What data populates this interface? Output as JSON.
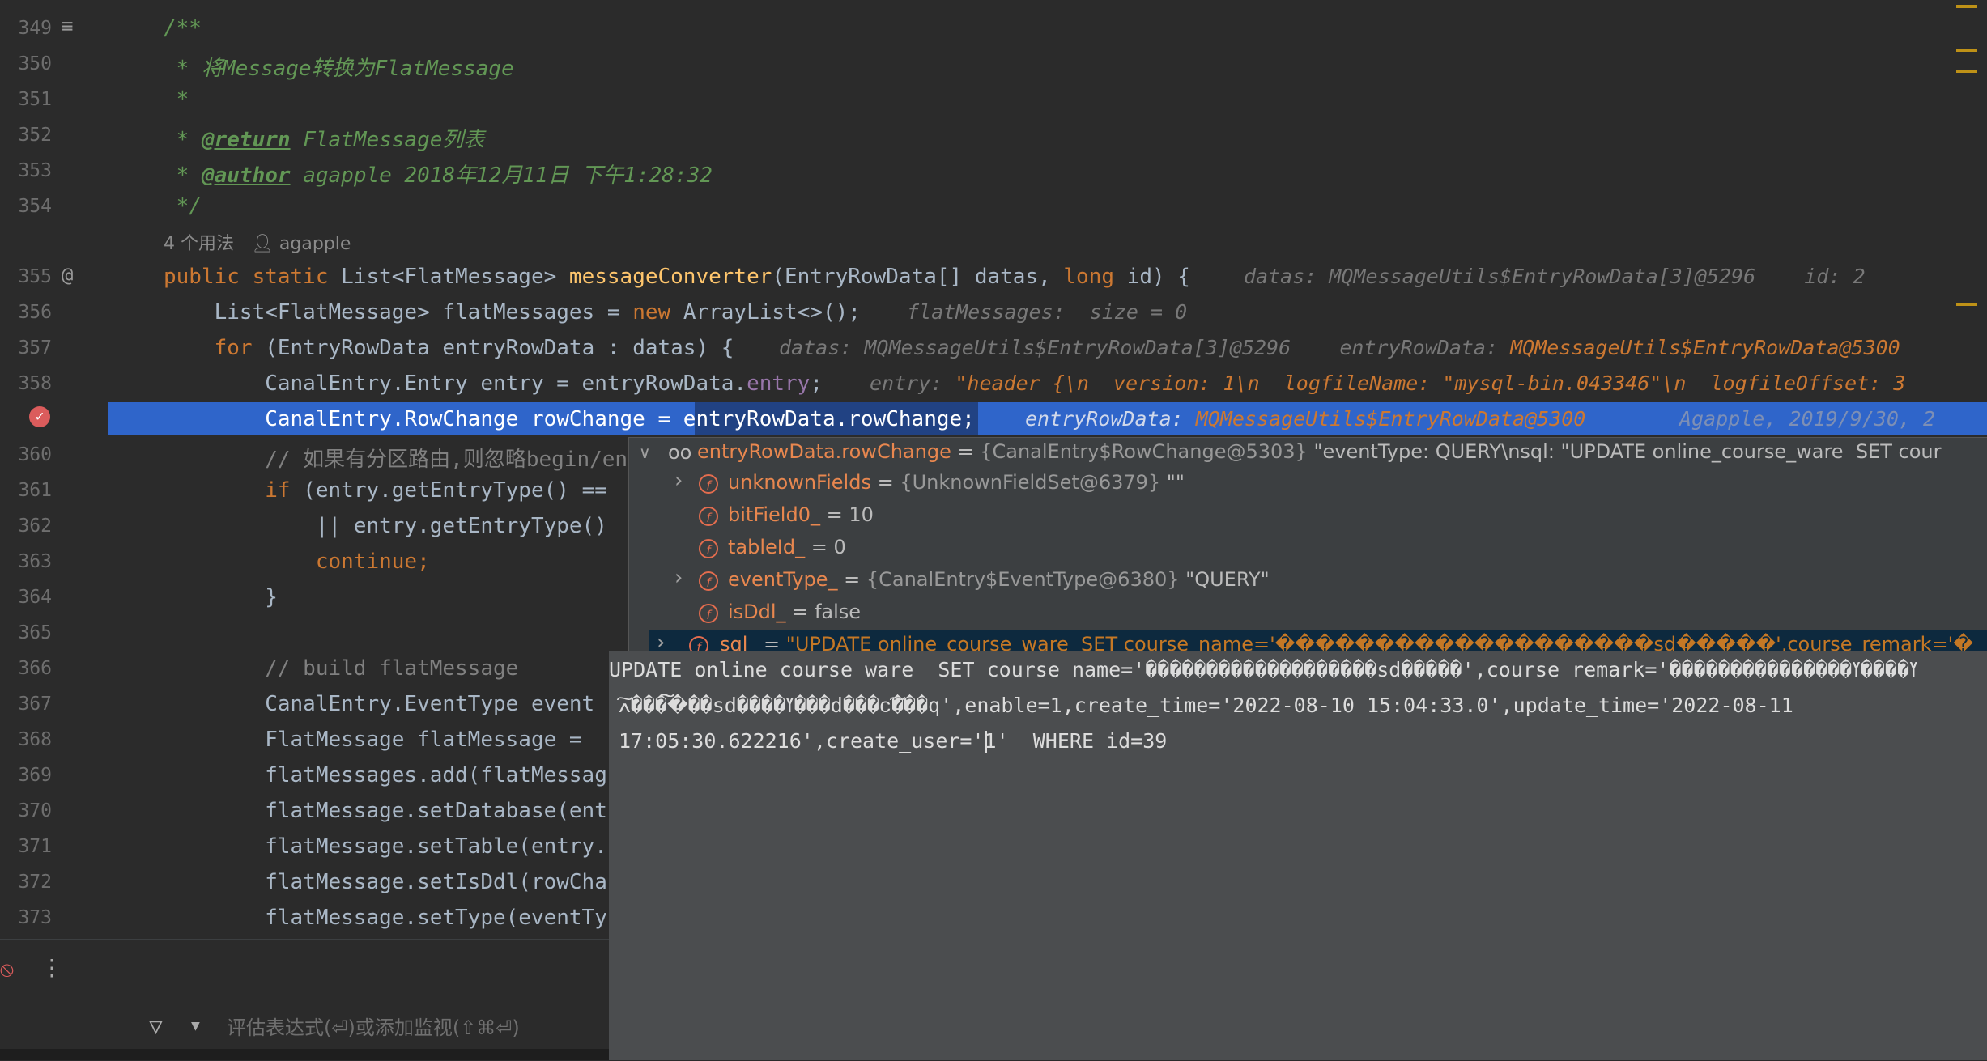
{
  "lines": [
    {
      "num": "349",
      "kind": "doc",
      "parts": [
        {
          "t": "/**",
          "c": "c"
        }
      ]
    },
    {
      "num": "350",
      "kind": "doc",
      "parts": [
        {
          "t": " * 将Message转换为FlatMessage",
          "c": "c"
        }
      ]
    },
    {
      "num": "351",
      "kind": "doc",
      "parts": [
        {
          "t": " *",
          "c": "c"
        }
      ]
    },
    {
      "num": "352",
      "kind": "doc",
      "parts": [
        {
          "t": " * ",
          "c": "c"
        },
        {
          "t": "@return",
          "c": "tag"
        },
        {
          "t": " FlatMessage列表",
          "c": "c"
        }
      ]
    },
    {
      "num": "353",
      "kind": "doc",
      "parts": [
        {
          "t": " * ",
          "c": "c"
        },
        {
          "t": "@author",
          "c": "tag"
        },
        {
          "t": " agapple 2018年12月11日 下午1:28:32",
          "c": "c"
        }
      ]
    },
    {
      "num": "354",
      "kind": "doc",
      "parts": [
        {
          "t": " */",
          "c": "c"
        }
      ]
    },
    {
      "num": "355",
      "parts": [
        {
          "t": "public static ",
          "c": "k"
        },
        {
          "t": "List<FlatMessage> "
        },
        {
          "t": "messageConverter",
          "c": "m"
        },
        {
          "t": "(EntryRowData[] datas, "
        },
        {
          "t": "long ",
          "c": "k"
        },
        {
          "t": "id) {"
        }
      ]
    },
    {
      "num": "356",
      "parts": [
        {
          "t": "    List<FlatMessage> flatMessages = "
        },
        {
          "t": "new ",
          "c": "k"
        },
        {
          "t": "ArrayList<>();"
        }
      ]
    },
    {
      "num": "357",
      "parts": [
        {
          "t": "    "
        },
        {
          "t": "for ",
          "c": "k"
        },
        {
          "t": "(EntryRowData entryRowData : datas) {"
        }
      ]
    },
    {
      "num": "358",
      "parts": [
        {
          "t": "        CanalEntry.Entry entry = entryRowData."
        },
        {
          "t": "entry",
          "c": "f"
        },
        {
          "t": ";"
        }
      ]
    },
    {
      "num": "359",
      "parts": [
        {
          "t": "        CanalEntry.RowChange rowChange = entryRowData."
        },
        {
          "t": "rowChange",
          "c": "f"
        },
        {
          "t": ";"
        }
      ]
    },
    {
      "num": "360",
      "parts": [
        {
          "t": "        // 如果有分区路由,则忽略begin/en",
          "c": "lc"
        }
      ]
    },
    {
      "num": "361",
      "parts": [
        {
          "t": "        "
        },
        {
          "t": "if ",
          "c": "k"
        },
        {
          "t": "(entry.getEntryType() =="
        }
      ]
    },
    {
      "num": "362",
      "parts": [
        {
          "t": "            || entry.getEntryType()"
        }
      ]
    },
    {
      "num": "363",
      "parts": [
        {
          "t": "            "
        },
        {
          "t": "continue;",
          "c": "k"
        }
      ]
    },
    {
      "num": "364",
      "parts": [
        {
          "t": "        }"
        }
      ]
    },
    {
      "num": "365",
      "parts": [
        {
          "t": ""
        }
      ]
    },
    {
      "num": "366",
      "parts": [
        {
          "t": "        // build flatMessage",
          "c": "lc"
        }
      ]
    },
    {
      "num": "367",
      "parts": [
        {
          "t": "        CanalEntry.EventType event"
        }
      ]
    },
    {
      "num": "368",
      "parts": [
        {
          "t": "        FlatMessage flatMessage = "
        }
      ]
    },
    {
      "num": "369",
      "parts": [
        {
          "t": "        flatMessages.add(flatMessag"
        }
      ]
    },
    {
      "num": "370",
      "parts": [
        {
          "t": "        flatMessage.setDatabase(ent"
        }
      ]
    },
    {
      "num": "371",
      "parts": [
        {
          "t": "        flatMessage.setTable(entry."
        }
      ]
    },
    {
      "num": "372",
      "parts": [
        {
          "t": "        flatMessage.setIsDdl(rowCha"
        }
      ]
    },
    {
      "num": "373",
      "parts": [
        {
          "t": "        flatMessage.setType(eventTy"
        }
      ]
    }
  ],
  "usages": {
    "count": "4 个用法",
    "author": "agapple"
  },
  "hints": {
    "h355": [
      {
        "t": "datas: MQMessageUtils$EntryRowData[3]@5296    id: 2"
      }
    ],
    "h356": [
      {
        "t": "flatMessages:  size = 0"
      }
    ],
    "h357": [
      {
        "t": "datas: MQMessageUtils$EntryRowData[3]@5296    entryRowData: "
      },
      {
        "t": "MQMessageUtils$EntryRowData@5300",
        "v": true
      }
    ],
    "h358": [
      {
        "t": "entry: "
      },
      {
        "t": "\"header {\\n  version: 1\\n  logfileName: \"mysql-bin.043346\"\\n  logfileOffset: 3",
        "v": true
      }
    ],
    "h359": [
      {
        "t": "entryRowData: "
      },
      {
        "t": "MQMessageUtils$EntryRowData@5300",
        "v": true
      }
    ],
    "h359blame": "Agapple, 2019/9/30, 2"
  },
  "popup": {
    "root": {
      "name": "entryRowData.rowChange",
      "type": "{CanalEntry$RowChange@5303}",
      "value": "\"eventType: QUERY\\nsql: \"UPDATE online_course_ware  SET cour"
    },
    "fields": [
      {
        "expand": true,
        "name": "unknownFields",
        "type": "{UnknownFieldSet@6379}",
        "value": "\"\""
      },
      {
        "expand": false,
        "name": "bitField0_",
        "type": "",
        "value": "10"
      },
      {
        "expand": false,
        "name": "tableId_",
        "type": "",
        "value": "0"
      },
      {
        "expand": true,
        "name": "eventType_",
        "type": "{CanalEntry$EventType@6380}",
        "value": "\"QUERY\""
      },
      {
        "expand": false,
        "name": "isDdl_",
        "type": "",
        "value": "false"
      },
      {
        "expand": true,
        "name": "sql_",
        "type": "",
        "value": "\"UPDATE online_course_ware  SET course_name='�������������������sd�����',course_remark='�"
      }
    ]
  },
  "tooltip": {
    "line1": "UPDATE online_course_ware  SET course_name='�������������������sd�����',course_remark='���������������ߌ����ߌ",
    "line2": "͠ߍ����͠͠��sd����ߌ���d���ᴄ͠���q',enable=1,create_time='2022-08-10 15:04:33.0',update_time='2022-08-11",
    "line3": "17:05:30.622216',create_user='1'  WHERE id=39"
  },
  "debug": {
    "watch_placeholder": "评估表达式(⏎)或添加监视(⇧⌘⏎)"
  }
}
